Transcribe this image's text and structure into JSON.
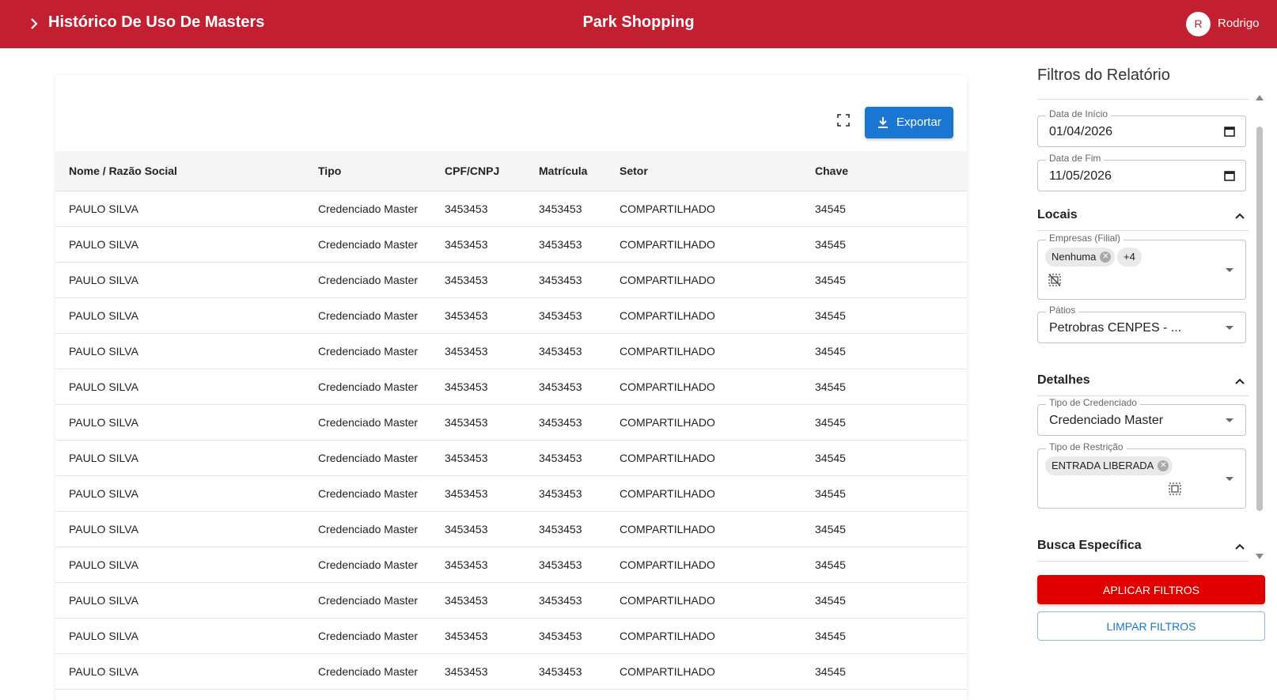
{
  "header": {
    "title": "Histórico De Uso De Masters",
    "location": "Park Shopping",
    "avatar_initial": "R",
    "user_name": "Rodrigo",
    "bg_color": "#c21f30"
  },
  "toolbar": {
    "export_label": "Exportar"
  },
  "table": {
    "columns": [
      "Nome / Razão Social",
      "Tipo",
      "CPF/CNPJ",
      "Matrícula",
      "Setor",
      "Chave"
    ],
    "rows": [
      [
        "PAULO SILVA",
        "Credenciado Master",
        "3453453",
        "3453453",
        "COMPARTILHADO",
        "34545"
      ],
      [
        "PAULO SILVA",
        "Credenciado Master",
        "3453453",
        "3453453",
        "COMPARTILHADO",
        "34545"
      ],
      [
        "PAULO SILVA",
        "Credenciado Master",
        "3453453",
        "3453453",
        "COMPARTILHADO",
        "34545"
      ],
      [
        "PAULO SILVA",
        "Credenciado Master",
        "3453453",
        "3453453",
        "COMPARTILHADO",
        "34545"
      ],
      [
        "PAULO SILVA",
        "Credenciado Master",
        "3453453",
        "3453453",
        "COMPARTILHADO",
        "34545"
      ],
      [
        "PAULO SILVA",
        "Credenciado Master",
        "3453453",
        "3453453",
        "COMPARTILHADO",
        "34545"
      ],
      [
        "PAULO SILVA",
        "Credenciado Master",
        "3453453",
        "3453453",
        "COMPARTILHADO",
        "34545"
      ],
      [
        "PAULO SILVA",
        "Credenciado Master",
        "3453453",
        "3453453",
        "COMPARTILHADO",
        "34545"
      ],
      [
        "PAULO SILVA",
        "Credenciado Master",
        "3453453",
        "3453453",
        "COMPARTILHADO",
        "34545"
      ],
      [
        "PAULO SILVA",
        "Credenciado Master",
        "3453453",
        "3453453",
        "COMPARTILHADO",
        "34545"
      ],
      [
        "PAULO SILVA",
        "Credenciado Master",
        "3453453",
        "3453453",
        "COMPARTILHADO",
        "34545"
      ],
      [
        "PAULO SILVA",
        "Credenciado Master",
        "3453453",
        "3453453",
        "COMPARTILHADO",
        "34545"
      ],
      [
        "PAULO SILVA",
        "Credenciado Master",
        "3453453",
        "3453453",
        "COMPARTILHADO",
        "34545"
      ],
      [
        "PAULO SILVA",
        "Credenciado Master",
        "3453453",
        "3453453",
        "COMPARTILHADO",
        "34545"
      ]
    ]
  },
  "filters": {
    "title": "Filtros do Relatório",
    "date_start": {
      "label": "Data de Início",
      "value": "01/04/2026"
    },
    "date_end": {
      "label": "Data de Fim",
      "value": "11/05/2026"
    },
    "locais": {
      "heading": "Locais",
      "empresas": {
        "label": "Empresas (Filial)",
        "chip": "Nenhuma",
        "more": "+4"
      },
      "patios": {
        "label": "Pátios",
        "value": "Petrobras CENPES - ..."
      }
    },
    "detalhes": {
      "heading": "Detalhes",
      "tipo_credenciado": {
        "label": "Tipo de Credenciado",
        "value": "Credenciado Master"
      },
      "tipo_restricao": {
        "label": "Tipo de Restrição",
        "chip": "ENTRADA LIBERADA"
      }
    },
    "busca": {
      "heading": "Busca Específica"
    },
    "apply_label": "APLICAR FILTROS",
    "clear_label": "LIMPAR FILTROS"
  }
}
